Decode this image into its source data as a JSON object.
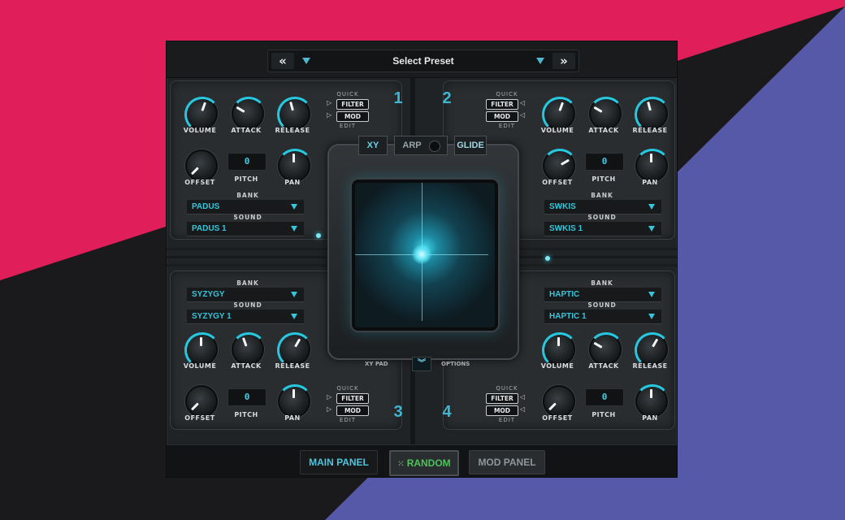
{
  "header": {
    "preset_label": "Select Preset",
    "prev_label": "«",
    "next_label": "»"
  },
  "sections": [
    {
      "number": "1",
      "volume": "VOLUME",
      "attack": "ATTACK",
      "release": "RELEASE",
      "offset": "OFFSET",
      "pitch": "PITCH",
      "pan": "PAN",
      "pitch_value": "0",
      "bank_label": "BANK",
      "bank_value": "PADUS",
      "sound_label": "SOUND",
      "sound_value": "PADUS 1",
      "quick": "QUICK",
      "filter": "FILTER",
      "mod": "MOD",
      "edit": "EDIT"
    },
    {
      "number": "2",
      "volume": "VOLUME",
      "attack": "ATTACK",
      "release": "RELEASE",
      "offset": "OFFSET",
      "pitch": "PITCH",
      "pan": "PAN",
      "pitch_value": "0",
      "bank_label": "BANK",
      "bank_value": "SWKIS",
      "sound_label": "SOUND",
      "sound_value": "SWKIS 1",
      "quick": "QUICK",
      "filter": "FILTER",
      "mod": "MOD",
      "edit": "EDIT"
    },
    {
      "number": "3",
      "volume": "VOLUME",
      "attack": "ATTACK",
      "release": "RELEASE",
      "offset": "OFFSET",
      "pitch": "PITCH",
      "pan": "PAN",
      "pitch_value": "0",
      "bank_label": "BANK",
      "bank_value": "SYZYGY",
      "sound_label": "SOUND",
      "sound_value": "SYZYGY 1",
      "quick": "QUICK",
      "filter": "FILTER",
      "mod": "MOD",
      "edit": "EDIT"
    },
    {
      "number": "4",
      "volume": "VOLUME",
      "attack": "ATTACK",
      "release": "RELEASE",
      "offset": "OFFSET",
      "pitch": "PITCH",
      "pan": "PAN",
      "pitch_value": "0",
      "bank_label": "BANK",
      "bank_value": "HAPTIC",
      "sound_label": "SOUND",
      "sound_value": "HAPTIC 1",
      "quick": "QUICK",
      "filter": "FILTER",
      "mod": "MOD",
      "edit": "EDIT"
    }
  ],
  "center": {
    "tab_xy": "XY",
    "tab_arp": "ARP",
    "tab_glide": "GLIDE",
    "xy_pad_label": "XY PAD",
    "options_label": "OPTIONS",
    "expand_icon": "chevron-double-down-icon"
  },
  "footer": {
    "main_panel": "MAIN PANEL",
    "random": "RANDOM",
    "mod_panel": "MOD PANEL"
  },
  "colors": {
    "accent": "#27c8df",
    "pink_bg": "#e01e5a",
    "blue_bg": "#5658a8",
    "dark_bg": "#1a1a1c",
    "random_green": "#4cc25a"
  }
}
